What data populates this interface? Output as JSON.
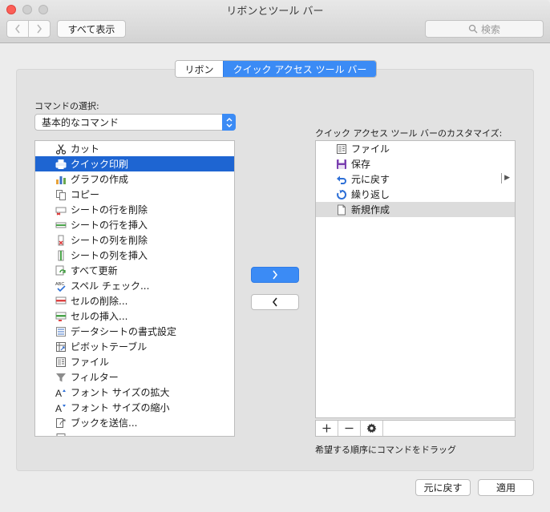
{
  "window": {
    "title": "リボンとツール バー"
  },
  "toolbar": {
    "back_icon": "chevron-left-icon",
    "forward_icon": "chevron-right-icon",
    "show_all_label": "すべて表示",
    "search_placeholder": "検索"
  },
  "tabs": [
    {
      "label": "リボン",
      "selected": false
    },
    {
      "label": "クイック アクセス ツール バー",
      "selected": true
    }
  ],
  "commands": {
    "choose_label": "コマンドの選択:",
    "selected_category": "基本的なコマンド",
    "items": [
      {
        "label": "カット",
        "icon": "scissors-icon"
      },
      {
        "label": "クイック印刷",
        "icon": "quick-print-icon",
        "selected": true
      },
      {
        "label": "グラフの作成",
        "icon": "bar-chart-icon"
      },
      {
        "label": "コピー",
        "icon": "copy-icon"
      },
      {
        "label": "シートの行を削除",
        "icon": "delete-row-icon"
      },
      {
        "label": "シートの行を挿入",
        "icon": "insert-row-icon"
      },
      {
        "label": "シートの列を削除",
        "icon": "delete-column-icon"
      },
      {
        "label": "シートの列を挿入",
        "icon": "insert-column-icon"
      },
      {
        "label": "すべて更新",
        "icon": "refresh-all-icon"
      },
      {
        "label": "スペル チェック...",
        "icon": "spell-check-icon"
      },
      {
        "label": "セルの削除...",
        "icon": "delete-cells-icon"
      },
      {
        "label": "セルの挿入...",
        "icon": "insert-cells-icon"
      },
      {
        "label": "データシートの書式設定",
        "icon": "datasheet-format-icon"
      },
      {
        "label": "ピボットテーブル",
        "icon": "pivot-table-icon"
      },
      {
        "label": "ファイル",
        "icon": "file-icon"
      },
      {
        "label": "フィルター",
        "icon": "filter-icon"
      },
      {
        "label": "フォント サイズの拡大",
        "icon": "font-size-increase-icon"
      },
      {
        "label": "フォント サイズの縮小",
        "icon": "font-size-decrease-icon"
      },
      {
        "label": "ブックを送信...",
        "icon": "send-workbook-icon"
      }
    ]
  },
  "qat": {
    "customize_label": "クイック アクセス ツール バーのカスタマイズ:",
    "items": [
      {
        "label": "ファイル",
        "icon": "file-icon"
      },
      {
        "label": "保存",
        "icon": "save-icon"
      },
      {
        "label": "元に戻す",
        "icon": "undo-icon",
        "has_submenu": true
      },
      {
        "label": "繰り返し",
        "icon": "redo-icon"
      },
      {
        "label": "新規作成",
        "icon": "new-document-icon",
        "highlighted": true
      }
    ],
    "add_icon": "plus-icon",
    "remove_icon": "minus-icon",
    "gear_icon": "gear-icon",
    "hint": "希望する順序にコマンドをドラッグ"
  },
  "buttons": {
    "add_icon": "chevron-right-icon",
    "remove_icon": "chevron-left-icon",
    "revert_label": "元に戻す",
    "apply_label": "適用"
  },
  "colors": {
    "accent": "#3b8bf5",
    "selection": "#1e65d2",
    "close": "#fc5f57"
  }
}
